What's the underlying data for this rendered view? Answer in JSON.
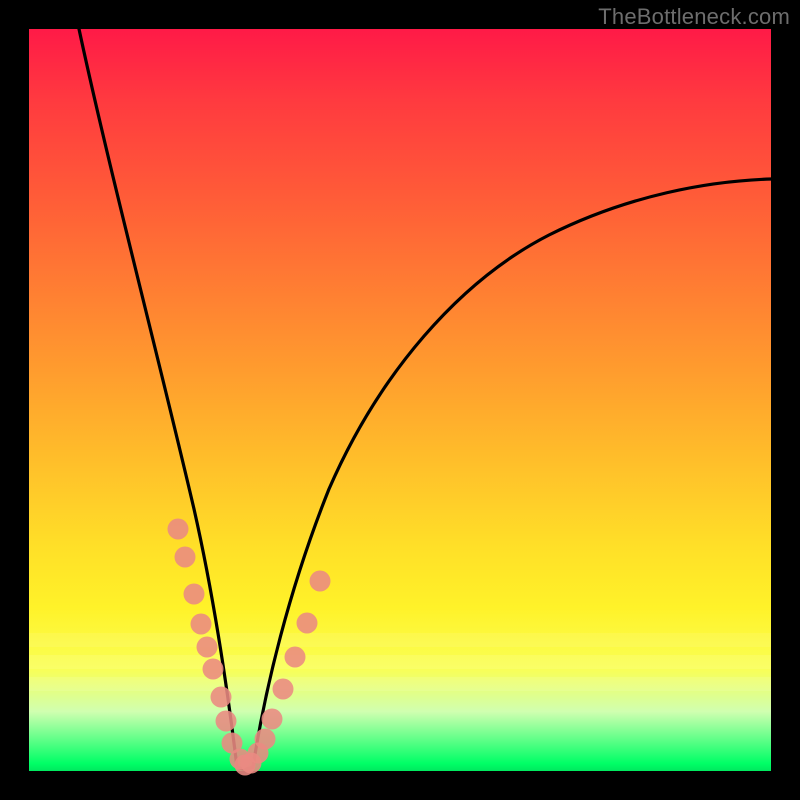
{
  "watermark": "TheBottleneck.com",
  "chart_data": {
    "type": "line",
    "title": "",
    "xlabel": "",
    "ylabel": "",
    "xlim": [
      0,
      100
    ],
    "ylim": [
      0,
      100
    ],
    "grid": false,
    "legend": false,
    "annotations": [],
    "series": [
      {
        "name": "left-branch",
        "style": "solid-black",
        "x": [
          6,
          8,
          10,
          12,
          14,
          16,
          18,
          20,
          22,
          24,
          25,
          26,
          27,
          28
        ],
        "values": [
          100,
          88,
          77,
          66,
          56,
          47,
          38,
          30,
          22,
          14,
          10,
          6,
          3,
          0
        ]
      },
      {
        "name": "right-branch",
        "style": "solid-black",
        "x": [
          30,
          31,
          32,
          34,
          36,
          38,
          40,
          44,
          48,
          54,
          60,
          68,
          76,
          84,
          92,
          100
        ],
        "values": [
          0,
          2,
          5,
          10,
          16,
          22,
          27,
          36,
          44,
          52,
          58,
          65,
          70,
          74,
          77,
          79
        ]
      },
      {
        "name": "points-overlay",
        "style": "dots-salmon",
        "x": [
          19.5,
          20.5,
          21.8,
          22.8,
          23.6,
          24.4,
          25.4,
          26.1,
          27.0,
          28.3,
          29.0,
          29.8,
          30.8,
          31.6,
          32.5,
          34.0,
          35.4,
          36.8,
          38.4
        ],
        "values": [
          33,
          29,
          24,
          20,
          17,
          14,
          10,
          7,
          4,
          2,
          1,
          1,
          2,
          4,
          7,
          11,
          15,
          20,
          26
        ]
      }
    ],
    "background_gradient": {
      "orientation": "vertical",
      "stops": [
        {
          "pos": 0.0,
          "color": "#ff1a47"
        },
        {
          "pos": 0.22,
          "color": "#ff5a38"
        },
        {
          "pos": 0.46,
          "color": "#ff9c2e"
        },
        {
          "pos": 0.7,
          "color": "#ffe028"
        },
        {
          "pos": 0.86,
          "color": "#faff53"
        },
        {
          "pos": 0.99,
          "color": "#00ff66"
        }
      ]
    },
    "glow_bands_y": [
      82,
      85,
      88
    ]
  }
}
